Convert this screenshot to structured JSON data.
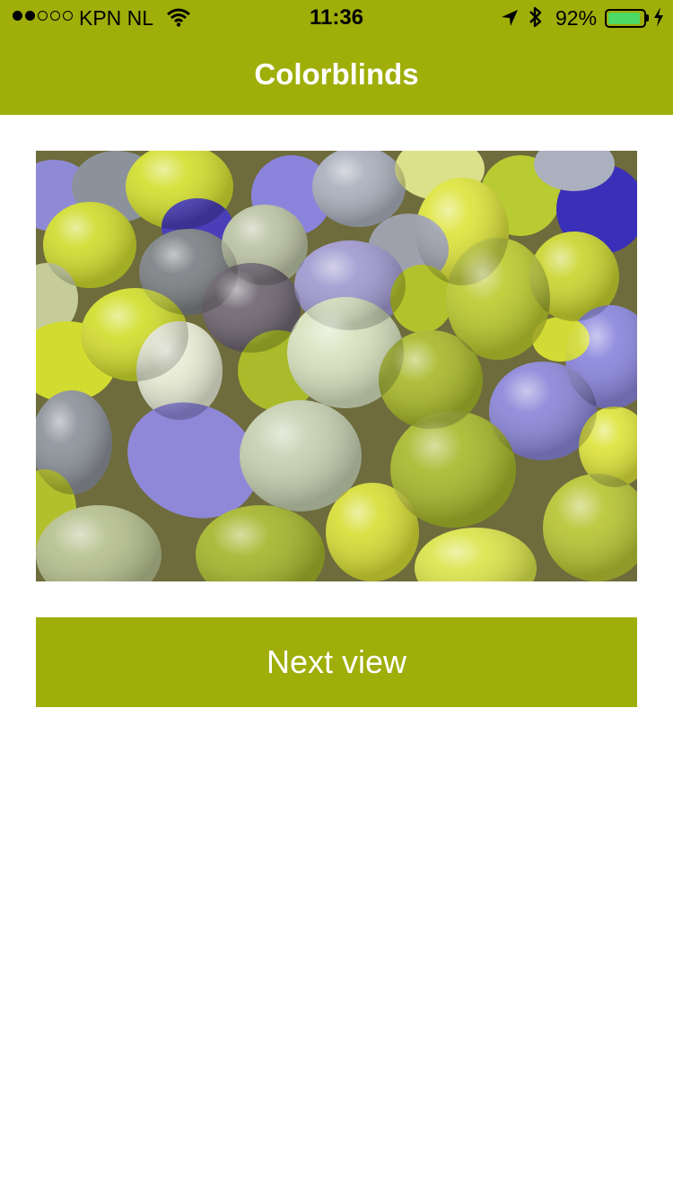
{
  "colors": {
    "accent": "#9fae09",
    "background": "#ffffff",
    "battery_fill": "#4cd964"
  },
  "status_bar": {
    "signal_bars_filled": 2,
    "signal_bars_total": 5,
    "carrier": "KPN NL",
    "time": "11:36",
    "battery_percent": "92%",
    "icons": [
      "wifi-icon",
      "location-arrow-icon",
      "bluetooth-icon",
      "battery-icon",
      "charging-bolt-icon"
    ]
  },
  "nav": {
    "title": "Colorblinds"
  },
  "main": {
    "image_subject": "balloons",
    "next_button_label": "Next view"
  }
}
